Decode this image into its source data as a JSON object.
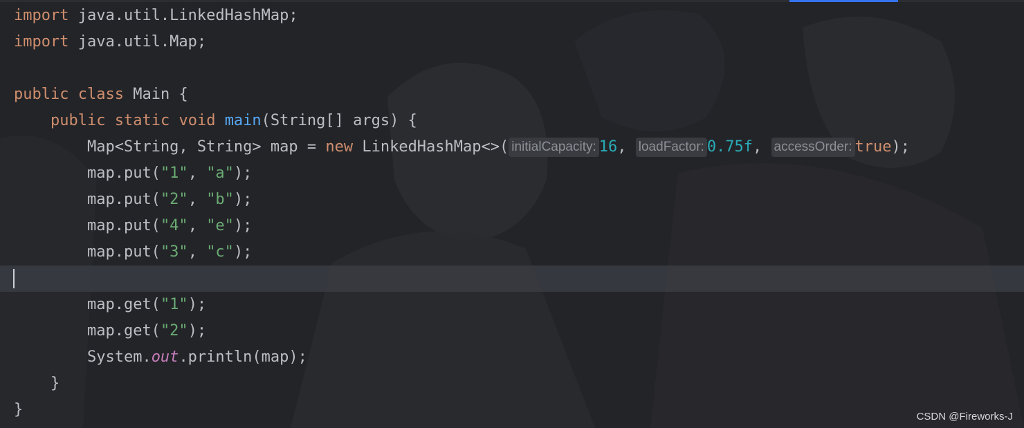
{
  "editor": {
    "lines": {
      "l1": {
        "kw": "import",
        "rest": " java.util.LinkedHashMap;"
      },
      "l2": {
        "kw": "import",
        "rest": " java.util.Map;"
      },
      "l4": {
        "kw1": "public",
        "kw2": "class",
        "rest": " Main {"
      },
      "l5": {
        "indent": "    ",
        "kw1": "public",
        "kw2": "static",
        "kw3": "void",
        "fn": "main",
        "rest": "(String[] args) {"
      },
      "l6": {
        "indent": "        ",
        "pre": "Map<String, String> map = ",
        "kw": "new",
        "mid": " LinkedHashMap<>(",
        "hint1": "initialCapacity:",
        "val1": "16",
        "sep1": ", ",
        "hint2": "loadFactor:",
        "val2": "0.75f",
        "sep2": ", ",
        "hint3": "accessOrder:",
        "val3": "true",
        "end": ");"
      },
      "l7": {
        "indent": "        ",
        "call": "map.put(",
        "arg1": "\"1\"",
        "sep": ", ",
        "arg2": "\"a\"",
        "end": ");"
      },
      "l8": {
        "indent": "        ",
        "call": "map.put(",
        "arg1": "\"2\"",
        "sep": ", ",
        "arg2": "\"b\"",
        "end": ");"
      },
      "l9": {
        "indent": "        ",
        "call": "map.put(",
        "arg1": "\"4\"",
        "sep": ", ",
        "arg2": "\"e\"",
        "end": ");"
      },
      "l10": {
        "indent": "        ",
        "call": "map.put(",
        "arg1": "\"3\"",
        "sep": ", ",
        "arg2": "\"c\"",
        "end": ");"
      },
      "l12": {
        "indent": "        ",
        "call": "map.get(",
        "arg1": "\"1\"",
        "end": ");"
      },
      "l13": {
        "indent": "        ",
        "call": "map.get(",
        "arg1": "\"2\"",
        "end": ");"
      },
      "l14": {
        "indent": "        ",
        "obj": "System.",
        "field": "out",
        "rest": ".println(map);"
      },
      "l15": {
        "text": "    }"
      },
      "l16": {
        "text": "}"
      }
    },
    "current_line": 11
  },
  "colors": {
    "background": "#232428",
    "keyword": "#cf8e6d",
    "method": "#56a8f5",
    "string": "#6aab73",
    "number": "#2aacb8",
    "static_field": "#c77dbb",
    "plain": "#bcbec4",
    "accent": "#3574f0"
  },
  "watermark": "CSDN @Fireworks-J"
}
